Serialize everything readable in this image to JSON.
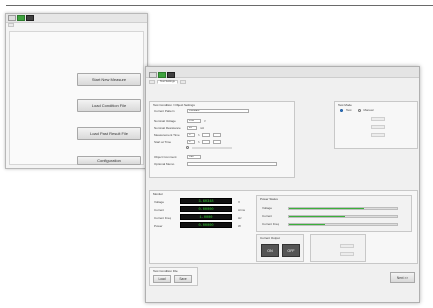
{
  "back_window": {
    "tabs": [
      "",
      "",
      ""
    ],
    "subtabs": [
      ""
    ],
    "buttons": {
      "first": "Start New Measure",
      "second": "Load Condition File",
      "third": "Load Past Result File",
      "fourth": "Configuration"
    }
  },
  "front_window": {
    "menu": [
      "",
      "",
      ""
    ],
    "tabs": [
      "",
      "",
      ""
    ],
    "subtabs": [
      "",
      "Test Settings",
      ""
    ],
    "test_conditions": {
      "title": "Test Condition / Object Settings",
      "rows": [
        {
          "label": "Current Pattern",
          "value": "Constant"
        },
        {
          "label": "Nominal Voltage",
          "value": "3.60",
          "unit": "V"
        },
        {
          "label": "Nominal Resistance",
          "value": "20",
          "unit": "mΩ"
        },
        {
          "label": "Measurement Time",
          "value": "0",
          "unit": "h"
        },
        {
          "label": "Start at Time",
          "value": "0",
          "unit": "h"
        },
        {
          "label": "Object Comment",
          "value": "Cell"
        },
        {
          "label": "Optional Memo",
          "value": ""
        }
      ]
    },
    "test_mode": {
      "title": "Test Mode",
      "option_a": "Test",
      "option_b": "Manual",
      "rows": [
        "",
        "",
        ""
      ]
    },
    "monitor": {
      "title": "Monitor",
      "readouts": [
        {
          "label": "Voltage",
          "value": "3.60348",
          "unit": "V"
        },
        {
          "label": "Current",
          "value": "0.00000",
          "unit": "Arms"
        },
        {
          "label": "Current Freq",
          "value": "1.0000",
          "unit": "Hz"
        },
        {
          "label": "Power",
          "value": "0.00000",
          "unit": "W"
        }
      ],
      "status_title": "Power Status",
      "bars": [
        {
          "label": "Voltage",
          "fill": 0.69
        },
        {
          "label": "Current",
          "fill": 0.52
        },
        {
          "label": "Current Freq",
          "fill": 0.33
        }
      ],
      "output_title": "Current Output",
      "output_buttons": [
        "ON",
        "OFF"
      ],
      "right_title": "",
      "right_fields": [
        "",
        ""
      ]
    },
    "footer": {
      "title": "Test Condition File",
      "buttons": [
        "Load",
        "Save"
      ],
      "next": "Next >>"
    },
    "accent": "#3bb03b",
    "readout_color": "#33d633"
  }
}
